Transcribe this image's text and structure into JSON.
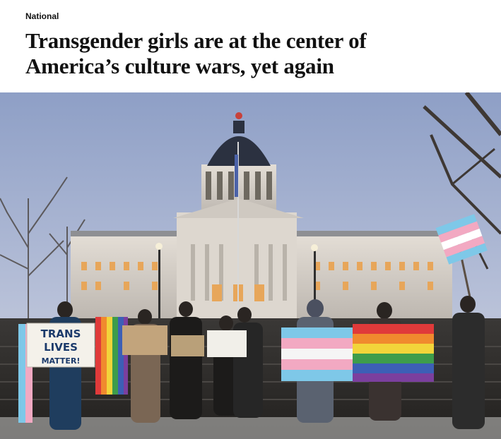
{
  "article": {
    "section": "National",
    "headline_line1": "Transgender girls are at the center of",
    "headline_line2": "America’s culture wars, yet again"
  },
  "photo": {
    "signs": {
      "trans_lives_line1": "TRANS",
      "trans_lives_line2": "LIVES",
      "trans_lives_line3": "MATTER!"
    }
  },
  "colors": {
    "sky_top": "#9aa9c9",
    "sky_bottom": "#cfd3df",
    "building": "#d9d4cc",
    "dome": "#2a2f3a",
    "trans_blue": "#7ec8e8",
    "trans_pink": "#f2a9c2",
    "text": "#111111"
  }
}
